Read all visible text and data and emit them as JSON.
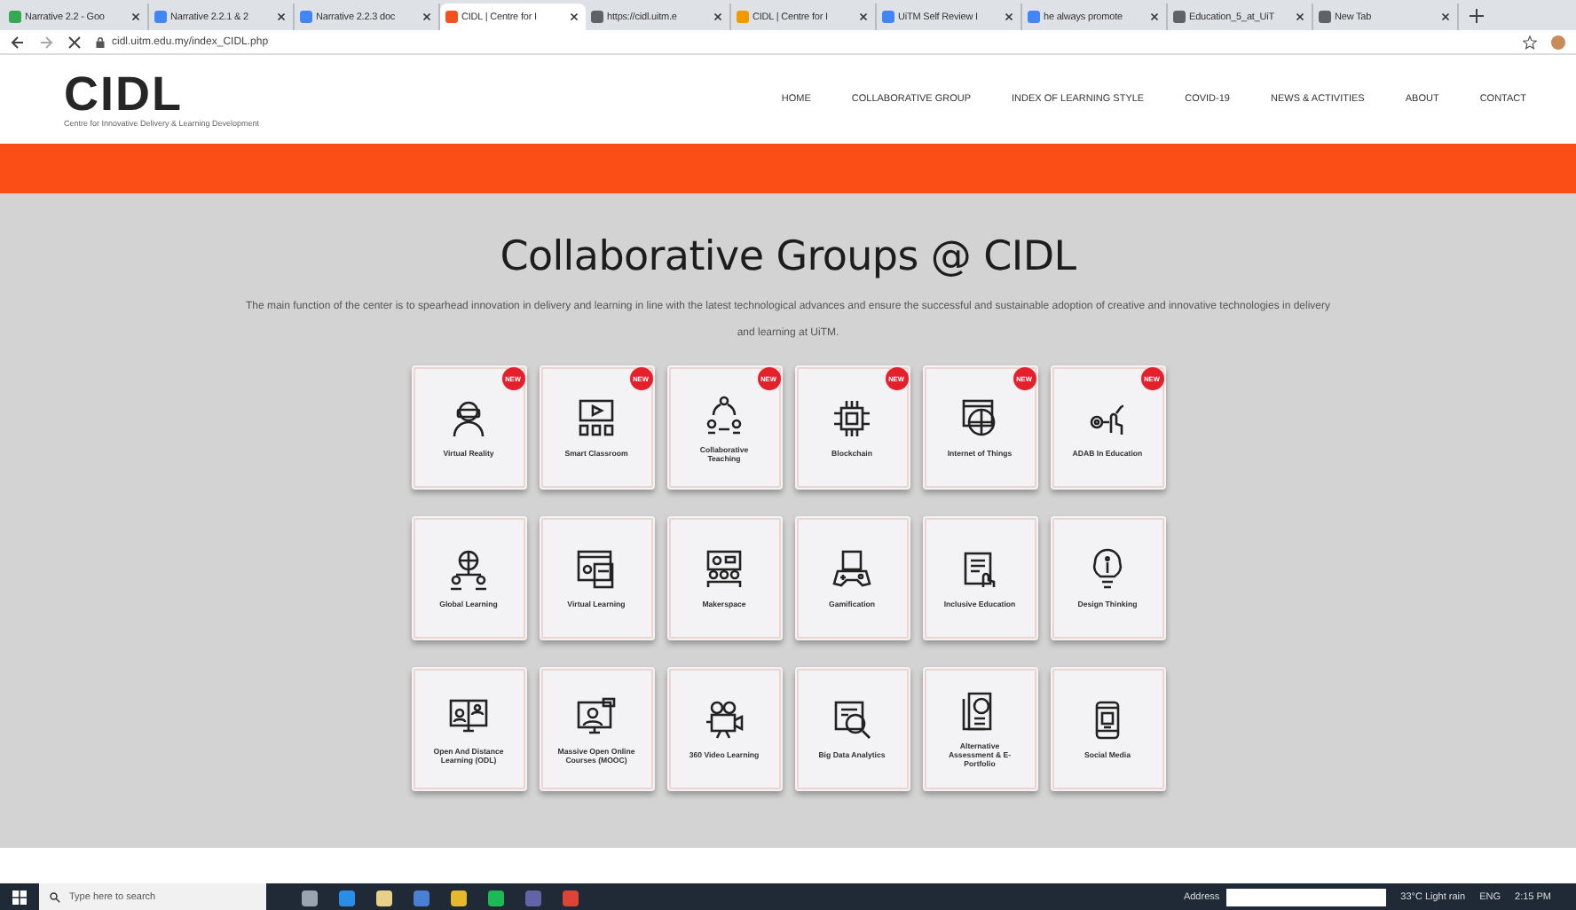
{
  "browser": {
    "tabs": [
      {
        "title": "Narrative 2.2 - Goo",
        "selected": false
      },
      {
        "title": "Narrative 2.2.1 & 2",
        "selected": false
      },
      {
        "title": "Narrative 2.2.3 doc",
        "selected": false
      },
      {
        "title": "CIDL | Centre for I",
        "selected": true
      },
      {
        "title": "https://cidl.uitm.e",
        "selected": false
      },
      {
        "title": "CIDL | Centre for I",
        "selected": false
      },
      {
        "title": "UiTM Self Review I",
        "selected": false
      },
      {
        "title": "he always promote",
        "selected": false
      },
      {
        "title": "Education_5_at_UiT",
        "selected": false
      },
      {
        "title": "New Tab",
        "selected": false
      }
    ],
    "url": "cidl.uitm.edu.my/index_CIDL.php"
  },
  "site": {
    "logo": "CIDL",
    "tagline": "Centre for Innovative Delivery & Learning Development",
    "nav": [
      "HOME",
      "COLLABORATIVE GROUP",
      "INDEX OF LEARNING STYLE",
      "COVID-19",
      "NEWS & ACTIVITIES",
      "ABOUT",
      "CONTACT"
    ]
  },
  "page": {
    "title": "Collaborative Groups @ CIDL",
    "description": "The main function of the center is to spearhead innovation in delivery and learning in line with the latest technological advances and ensure the successful and sustainable adoption of creative and innovative technologies in delivery and learning at UiTM.",
    "groups": [
      {
        "label": "Virtual Reality",
        "badge": "NEW"
      },
      {
        "label": "Smart Classroom",
        "badge": "NEW"
      },
      {
        "label": "Collaborative Teaching",
        "badge": "NEW"
      },
      {
        "label": "Blockchain",
        "badge": "NEW"
      },
      {
        "label": "Internet of Things",
        "badge": "NEW"
      },
      {
        "label": "ADAB In Education",
        "badge": "NEW"
      },
      {
        "label": "Global Learning"
      },
      {
        "label": "Virtual Learning"
      },
      {
        "label": "Makerspace"
      },
      {
        "label": "Gamification"
      },
      {
        "label": "Inclusive Education"
      },
      {
        "label": "Design Thinking"
      },
      {
        "label": "Open And Distance Learning (ODL)"
      },
      {
        "label": "Massive Open Online Courses (MOOC)"
      },
      {
        "label": "360 Video Learning"
      },
      {
        "label": "Big Data Analytics"
      },
      {
        "label": "Alternative Assessment & E-Portfolio"
      },
      {
        "label": "Social Media"
      }
    ]
  },
  "taskbar": {
    "search_placeholder": "Type here to search",
    "address_label": "Address",
    "weather": "33°C  Light rain",
    "language": "ENG",
    "time": "2:15 PM"
  }
}
